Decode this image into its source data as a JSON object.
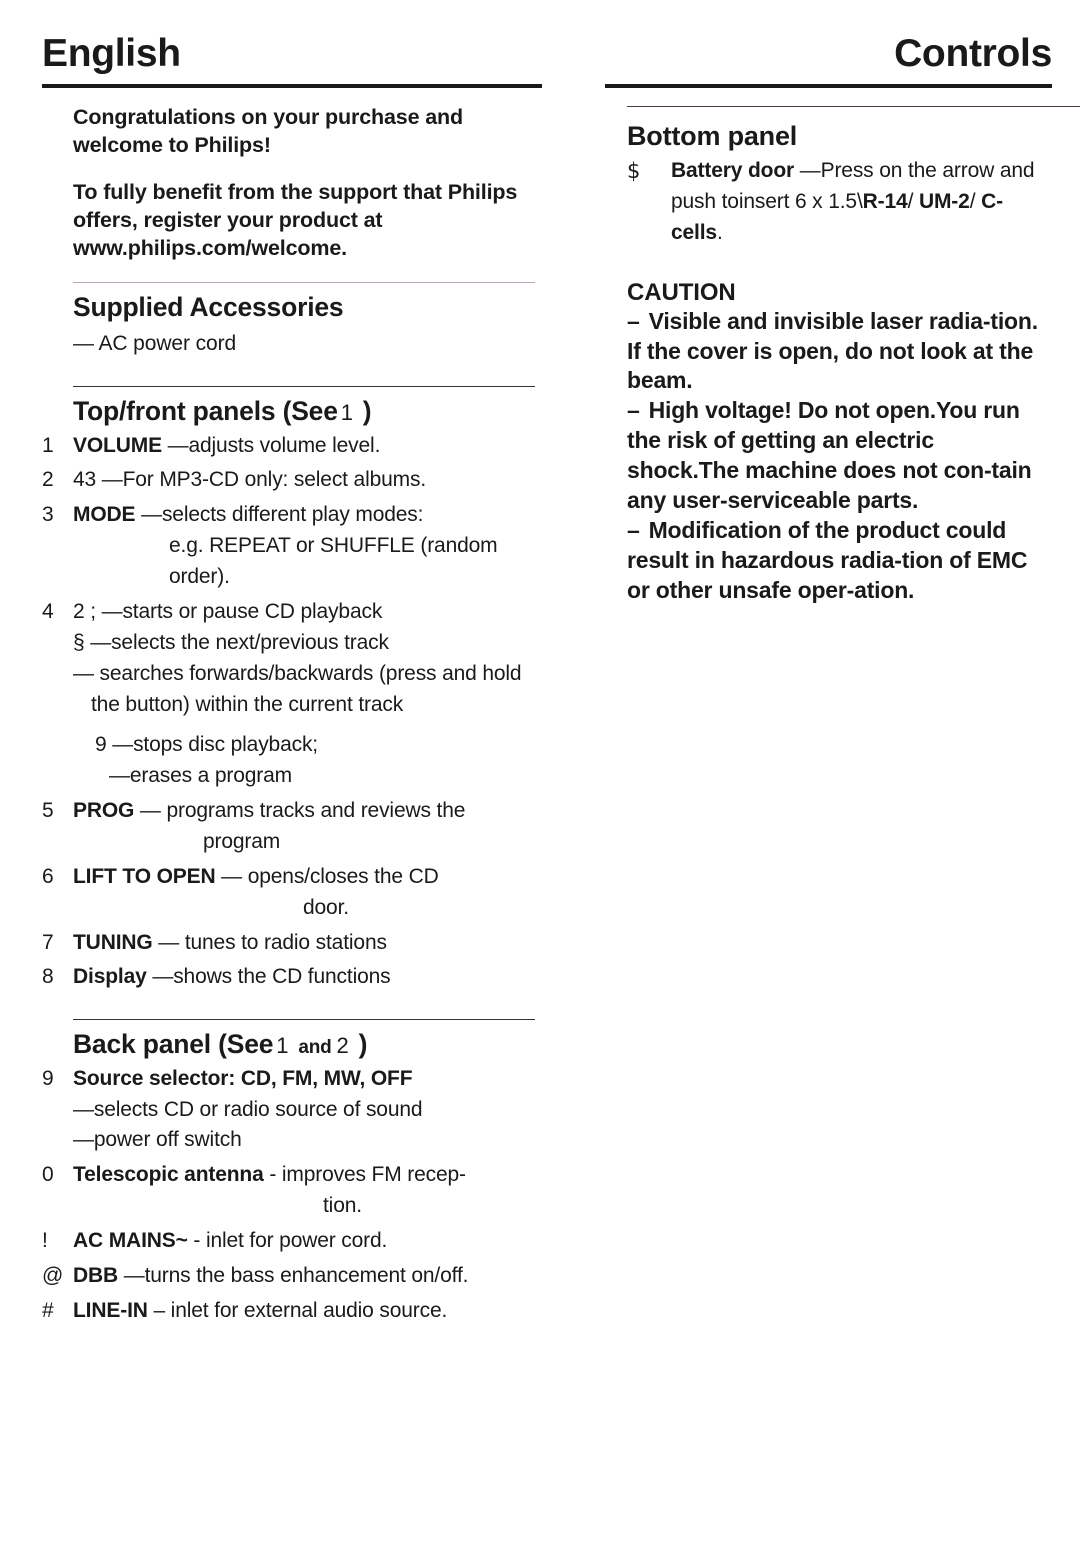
{
  "left": {
    "page_title": "English",
    "intro": [
      "Congratulations on your purchase and welcome to Philips!",
      "To fully benefit from the support that Philips offers, register your product at www.philips.com/welcome."
    ],
    "accessories": {
      "heading": "Supplied Accessories",
      "item": "— AC power cord"
    },
    "topfront": {
      "heading_main": "Top/front panels (See",
      "heading_fignum": "1",
      "heading_close": ")",
      "items": [
        {
          "marker": "1",
          "bold": "VOLUME",
          "rest": " —adjusts volume level."
        },
        {
          "marker": "2",
          "bold": "43",
          "rest": "   —For MP3-CD only: select albums."
        },
        {
          "marker": "3",
          "bold": "MODE",
          "rest": " —selects different play modes:",
          "cont": "e.g. REPEAT or SHUFFLE (random",
          "cont2": "order)."
        },
        {
          "marker": "4",
          "bold": "2  ;",
          "rest": "  —starts or pause CD playback",
          "sub_sym": "§",
          "sub_sym_rest": "        —selects the next/previous track",
          "sub_dash": "— searches forwards/backwards (press and hold the button) within the current track",
          "sub_stop": "9 —stops disc playback;",
          "sub_erase": "—erases a program"
        },
        {
          "marker": "5",
          "bold": "PROG",
          "rest": " — programs tracks and reviews the",
          "cont": "program"
        },
        {
          "marker": "6",
          "bold": "LIFT TO OPEN",
          "rest": "  — opens/closes the CD",
          "cont": "door."
        },
        {
          "marker": "7",
          "bold": "TUNING",
          "rest": " — tunes to radio stations"
        },
        {
          "marker": "8",
          "bold": "Display",
          "rest": " —shows the CD functions"
        }
      ]
    },
    "backpanel": {
      "heading_main": "Back panel (See",
      "heading_fignum": "1",
      "heading_and": "and",
      "heading_fignum2": "2",
      "heading_close": ")",
      "items": [
        {
          "marker": "9",
          "bold": "Source selector",
          "bold_cont": ": CD, FM, MW, OFF",
          "sub1": "—selects CD or radio source of sound",
          "sub2": "—power off switch"
        },
        {
          "marker": "0",
          "bold": "Telescopic antenna",
          "rest": " - improves FM recep-",
          "cont": "tion."
        },
        {
          "marker": "!",
          "bold": "AC MAINS~",
          "rest": " - inlet for power cord."
        },
        {
          "marker": "@",
          "bold": "DBB",
          "rest": " —turns the bass enhancement on/off."
        },
        {
          "marker": "#",
          "bold": "LINE-IN",
          "rest": " – inlet for external audio source."
        }
      ]
    }
  },
  "right": {
    "page_title": "Controls",
    "bottompanel": {
      "heading": "Bottom panel",
      "items": [
        {
          "marker": "$",
          "bold": "Battery door",
          "rest": " —Press on the arrow and push toinsert 6 x 1.5\\",
          "bold2": "R-14",
          "mid2": "/ ",
          "bold3": "UM-2",
          "mid3": "/ ",
          "bold4": "C-cells",
          "tail": "."
        }
      ]
    },
    "caution": {
      "heading": "CAUTION",
      "paragraphs": [
        {
          "dash": "–",
          "text": "Visible and invisible laser radia-tion. If the cover is open, do not look at the beam."
        },
        {
          "dash": "–",
          "text": "High voltage! Do not open.You run the risk of getting an electric shock.The machine does not con-tain any user-serviceable parts."
        },
        {
          "dash": "–",
          "text": "Modification of the product could result in hazardous radia-tion of EMC or other unsafe oper-ation."
        }
      ]
    }
  },
  "colors": {
    "text": "#1a1a1a",
    "rule_dark": "#1a1a1a",
    "rule_mauve": "#b9a6bb",
    "page_bg": "#ffffff"
  }
}
